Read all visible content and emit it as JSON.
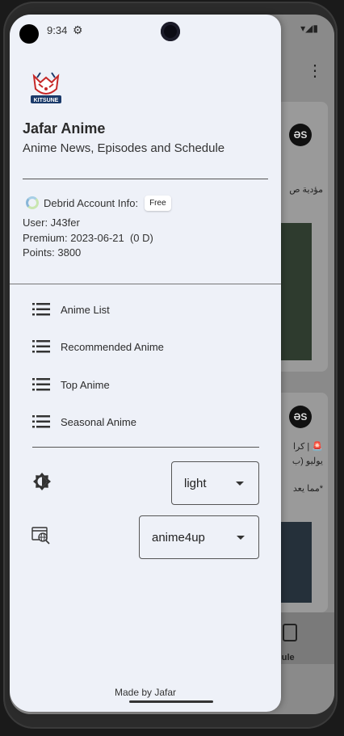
{
  "status": {
    "time": "9:34"
  },
  "drawer": {
    "app_title": "Jafar Anime",
    "app_subtitle": "Anime News, Episodes and Schedule",
    "logo_text": "KITSUNE",
    "debrid_label": "Debrid Account Info:",
    "debrid_badge": "Free",
    "user_line": "User: J43fer",
    "premium_line": "Premium: 2023-06-21  (0 D)",
    "points_line": "Points: 3800",
    "nav": [
      {
        "label": "Anime List",
        "icon": "list-icon"
      },
      {
        "label": "Recommended Anime",
        "icon": "list-icon"
      },
      {
        "label": "Top Anime",
        "icon": "list-icon"
      },
      {
        "label": "Seasonal Anime",
        "icon": "list-icon"
      }
    ],
    "theme_select": {
      "icon": "brightness-icon",
      "value": "light"
    },
    "source_select": {
      "icon": "language-icon",
      "value": "anime4up"
    },
    "footer": "Made by Jafar"
  },
  "background": {
    "card_logo_text": "ƏS",
    "card1_text": "مؤدية ص",
    "card2_text_1": "🚨 | كرا",
    "card2_text_2": "يوليو (ب",
    "card2_text_3": "*مما يعد",
    "bottom_label": "dule"
  },
  "colors": {
    "drawer_bg": "#eef1f8",
    "scrim": "#8a8a8a",
    "accent": "#2b2b2b"
  }
}
